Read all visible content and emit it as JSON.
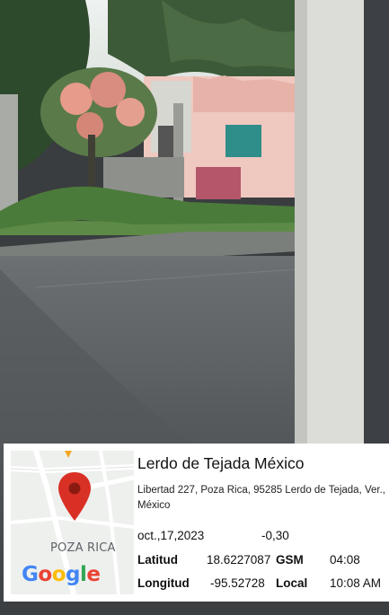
{
  "location": {
    "title": "Lerdo de Tejada México",
    "address": "Libertad 227, Poza Rica, 95285 Lerdo de Tejada, Ver., México",
    "date": "oct.,17,2023",
    "offset": "-0,30"
  },
  "coords": {
    "lat_label": "Latitud",
    "lat_value": "18.6227087",
    "gsm_label": "GSM",
    "gsm_time": "04:08",
    "lon_label": "Longitud",
    "lon_value": "-95.52728",
    "local_label": "Local",
    "local_time": "10:08 AM"
  },
  "map": {
    "city_label": "POZA RICA",
    "logo_text": "Google",
    "pin_color": "#d93025"
  }
}
